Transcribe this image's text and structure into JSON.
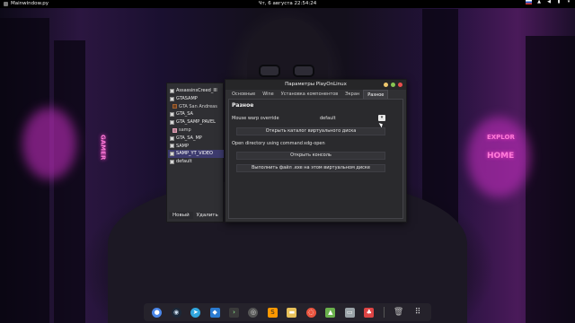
{
  "topbar": {
    "app_name": "Mainwindow.py",
    "datetime": "Чт, 6 августа 22:54:24"
  },
  "prefixes": [
    {
      "label": "AssassinsCreed_III",
      "icon": "prefix-icon",
      "child": false,
      "selected": false
    },
    {
      "label": "GTASAMP",
      "icon": "prefix-icon",
      "child": false,
      "selected": false
    },
    {
      "label": "GTA San Andreas",
      "icon": "game-icon",
      "child": true,
      "selected": false
    },
    {
      "label": "GTA_SA",
      "icon": "prefix-icon",
      "child": false,
      "selected": false
    },
    {
      "label": "GTA_SAMP_PAVEL",
      "icon": "prefix-icon",
      "child": false,
      "selected": false
    },
    {
      "label": "samp",
      "icon": "samp-icon",
      "child": true,
      "selected": false
    },
    {
      "label": "GTA_SA_MP",
      "icon": "prefix-icon",
      "child": false,
      "selected": false
    },
    {
      "label": "SAMP",
      "icon": "prefix-icon",
      "child": false,
      "selected": false
    },
    {
      "label": "SAMP_YT_VIDEO",
      "icon": "prefix-icon",
      "child": false,
      "selected": true
    },
    {
      "label": "default",
      "icon": "prefix-icon",
      "child": false,
      "selected": false
    }
  ],
  "leftpanel": {
    "new_label": "Новый",
    "delete_label": "Удалить"
  },
  "dialog": {
    "title": "Параметры PlayOnLinux",
    "tabs": [
      {
        "label": "Основные",
        "active": false
      },
      {
        "label": "Wine",
        "active": false
      },
      {
        "label": "Установка компонентов",
        "active": false
      },
      {
        "label": "Экран",
        "active": false
      },
      {
        "label": "Разное",
        "active": true
      }
    ],
    "section_title": "Разное",
    "mouse_warp_label": "Mouse warp override",
    "mouse_warp_value": "default",
    "open_virtual_disk_label": "Открыть каталог виртуального диска",
    "open_dir_cmd_label": "Open directory using command",
    "open_dir_cmd_value": "xdg-open",
    "open_console_label": "Открыть консоль",
    "run_exe_label": "Выполнить файл .exe на этом виртуальном диске"
  },
  "wallpaper": {
    "sign_left": "GAMER",
    "sign_right_1": "EXPLOR",
    "sign_right_2": "HOME"
  },
  "dock": {
    "items": [
      "chromium-icon",
      "steam-icon",
      "telegram-icon",
      "vscode-icon",
      "terminal-icon",
      "git-icon",
      "sublime-icon",
      "files-icon",
      "ubuntu-icon",
      "android-studio-icon",
      "disks-icon",
      "playonlinux-icon",
      "trash-icon",
      "show-apps-icon"
    ]
  },
  "colors": {
    "selection": "#3d3b6e",
    "min": "#eec76d",
    "max": "#88c553",
    "close": "#eb4e4e"
  }
}
